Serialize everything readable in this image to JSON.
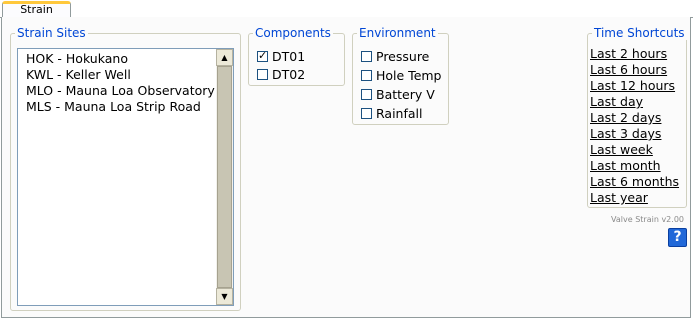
{
  "tabs": [
    {
      "label": "Strain",
      "active": true
    }
  ],
  "strain_sites": {
    "legend": "Strain Sites",
    "items": [
      "HOK - Hokukano",
      "KWL - Keller Well",
      "MLO - Mauna Loa Observatory",
      "MLS - Mauna Loa Strip Road"
    ]
  },
  "components": {
    "legend": "Components",
    "items": [
      {
        "label": "DT01",
        "checked": true
      },
      {
        "label": "DT02",
        "checked": false
      }
    ]
  },
  "environment": {
    "legend": "Environment",
    "items": [
      {
        "label": "Pressure",
        "checked": false
      },
      {
        "label": "Hole Temp",
        "checked": false
      },
      {
        "label": "Battery V",
        "checked": false
      },
      {
        "label": "Rainfall",
        "checked": false
      }
    ]
  },
  "time_shortcuts": {
    "legend": "Time Shortcuts",
    "items": [
      "Last 2 hours",
      "Last 6 hours",
      "Last 12 hours",
      "Last day",
      "Last 2 days",
      "Last 3 days",
      "Last week",
      "Last month",
      "Last 6 months",
      "Last year"
    ]
  },
  "version_text": "Valve Strain v2.00",
  "help_label": "?",
  "icons": {
    "help": "help-icon",
    "checkmark": "checkmark-icon",
    "scroll_up": "arrow-up-icon",
    "scroll_down": "arrow-down-icon"
  },
  "colors": {
    "legend": "#0046d5",
    "tab_accent": "#ffc83c",
    "help_button": "#2168d8"
  }
}
